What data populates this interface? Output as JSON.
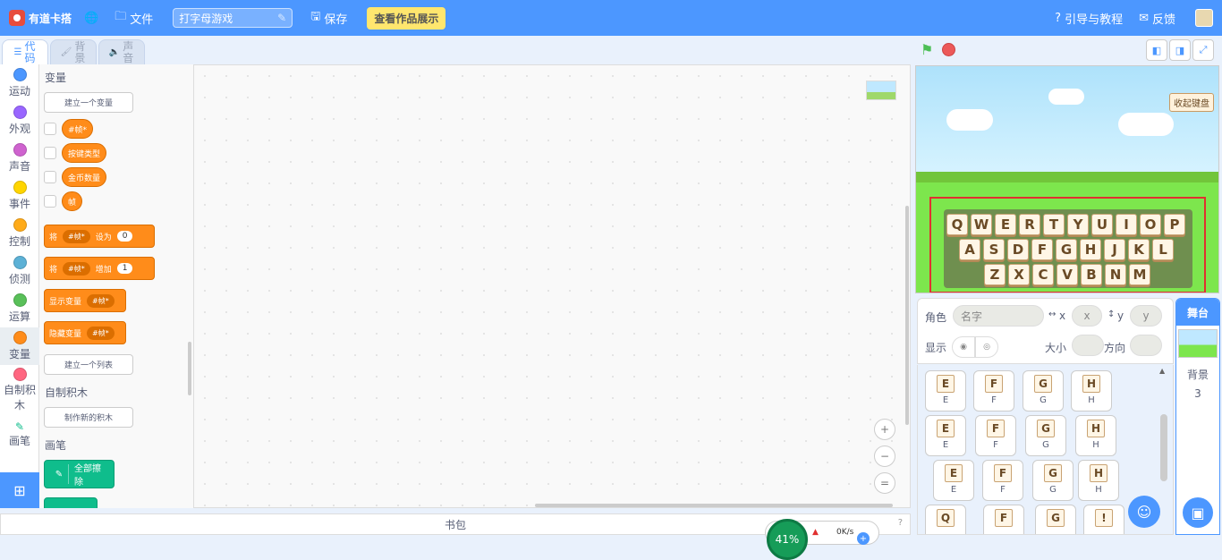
{
  "topbar": {
    "logo_text": "有道卡搭",
    "file_label": "文件",
    "project_name": "打字母游戏",
    "save_label": "保存",
    "showcase_label": "查看作品展示",
    "guide_label": "引导与教程",
    "feedback_label": "反馈"
  },
  "tabs": [
    {
      "label": "代码",
      "icon": "code-icon"
    },
    {
      "label": "背景",
      "icon": "brush-icon"
    },
    {
      "label": "声音",
      "icon": "speaker-icon"
    }
  ],
  "categories": [
    {
      "label": "运动",
      "color": "#4c97ff"
    },
    {
      "label": "外观",
      "color": "#9966ff"
    },
    {
      "label": "声音",
      "color": "#cf63cf"
    },
    {
      "label": "事件",
      "color": "#ffd500"
    },
    {
      "label": "控制",
      "color": "#ffab19"
    },
    {
      "label": "侦测",
      "color": "#5cb1d6"
    },
    {
      "label": "运算",
      "color": "#59c059"
    },
    {
      "label": "变量",
      "color": "#ff8c1a"
    },
    {
      "label": "自制积木",
      "color": "#ff6680"
    },
    {
      "label": "画笔",
      "color": "#0fbd8c"
    }
  ],
  "palette": {
    "variables_heading": "变量",
    "make_variable": "建立一个变量",
    "variables": [
      "#帧*",
      "按键类型",
      "金币数量",
      "帧"
    ],
    "set_block": {
      "prefix": "将",
      "var": "#帧*",
      "mid": "设为",
      "value": "0"
    },
    "change_block": {
      "prefix": "将",
      "var": "#帧*",
      "mid": "增加",
      "value": "1"
    },
    "show_block": {
      "prefix": "显示变量",
      "var": "#帧*"
    },
    "hide_block": {
      "prefix": "隐藏变量",
      "var": "#帧*"
    },
    "make_list": "建立一个列表",
    "myblocks_heading": "自制积木",
    "make_block": "制作新的积木",
    "pen_heading": "画笔",
    "pen_clear": "全部擦除"
  },
  "workspace": {
    "zoom_in": "+",
    "zoom_out": "−",
    "zoom_reset": "="
  },
  "backpack": {
    "label": "书包",
    "help": "?"
  },
  "stage": {
    "fold_keyboard": "收起键盘",
    "keyboard_rows": [
      [
        "Q",
        "W",
        "E",
        "R",
        "T",
        "Y",
        "U",
        "I",
        "O",
        "P"
      ],
      [
        "A",
        "S",
        "D",
        "F",
        "G",
        "H",
        "J",
        "K",
        "L"
      ],
      [
        "Z",
        "X",
        "C",
        "V",
        "B",
        "N",
        "M"
      ]
    ]
  },
  "sprite_info": {
    "sprite_label": "角色",
    "name_placeholder": "名字",
    "x_label": "x",
    "x_placeholder": "x",
    "y_label": "y",
    "y_placeholder": "y",
    "show_label": "显示",
    "size_label": "大小",
    "direction_label": "方向"
  },
  "sprites": [
    {
      "letter": "E",
      "name": "E"
    },
    {
      "letter": "F",
      "name": "F"
    },
    {
      "letter": "G",
      "name": "G"
    },
    {
      "letter": "H",
      "name": "H"
    },
    {
      "letter": "E",
      "name": "E"
    },
    {
      "letter": "F",
      "name": "F"
    },
    {
      "letter": "G",
      "name": "G"
    },
    {
      "letter": "H",
      "name": "H"
    },
    {
      "letter": "E",
      "name": "E"
    },
    {
      "letter": "F",
      "name": "F"
    },
    {
      "letter": "G",
      "name": "G"
    },
    {
      "letter": "H",
      "name": "H"
    },
    {
      "letter": "Q",
      "name": ""
    },
    {
      "letter": "F",
      "name": ""
    },
    {
      "letter": "G",
      "name": ""
    },
    {
      "letter": "!",
      "name": ""
    }
  ],
  "stage_panel": {
    "header": "舞台",
    "backdrop_label": "背景",
    "backdrop_count": "3"
  },
  "net_widget": {
    "percent": "41%",
    "speed": "0K/s"
  },
  "colors": {
    "topbar": "#4c97ff",
    "variables": "#ff8c1a",
    "pen": "#0fbd8c",
    "highlight_box": "#e03030"
  }
}
